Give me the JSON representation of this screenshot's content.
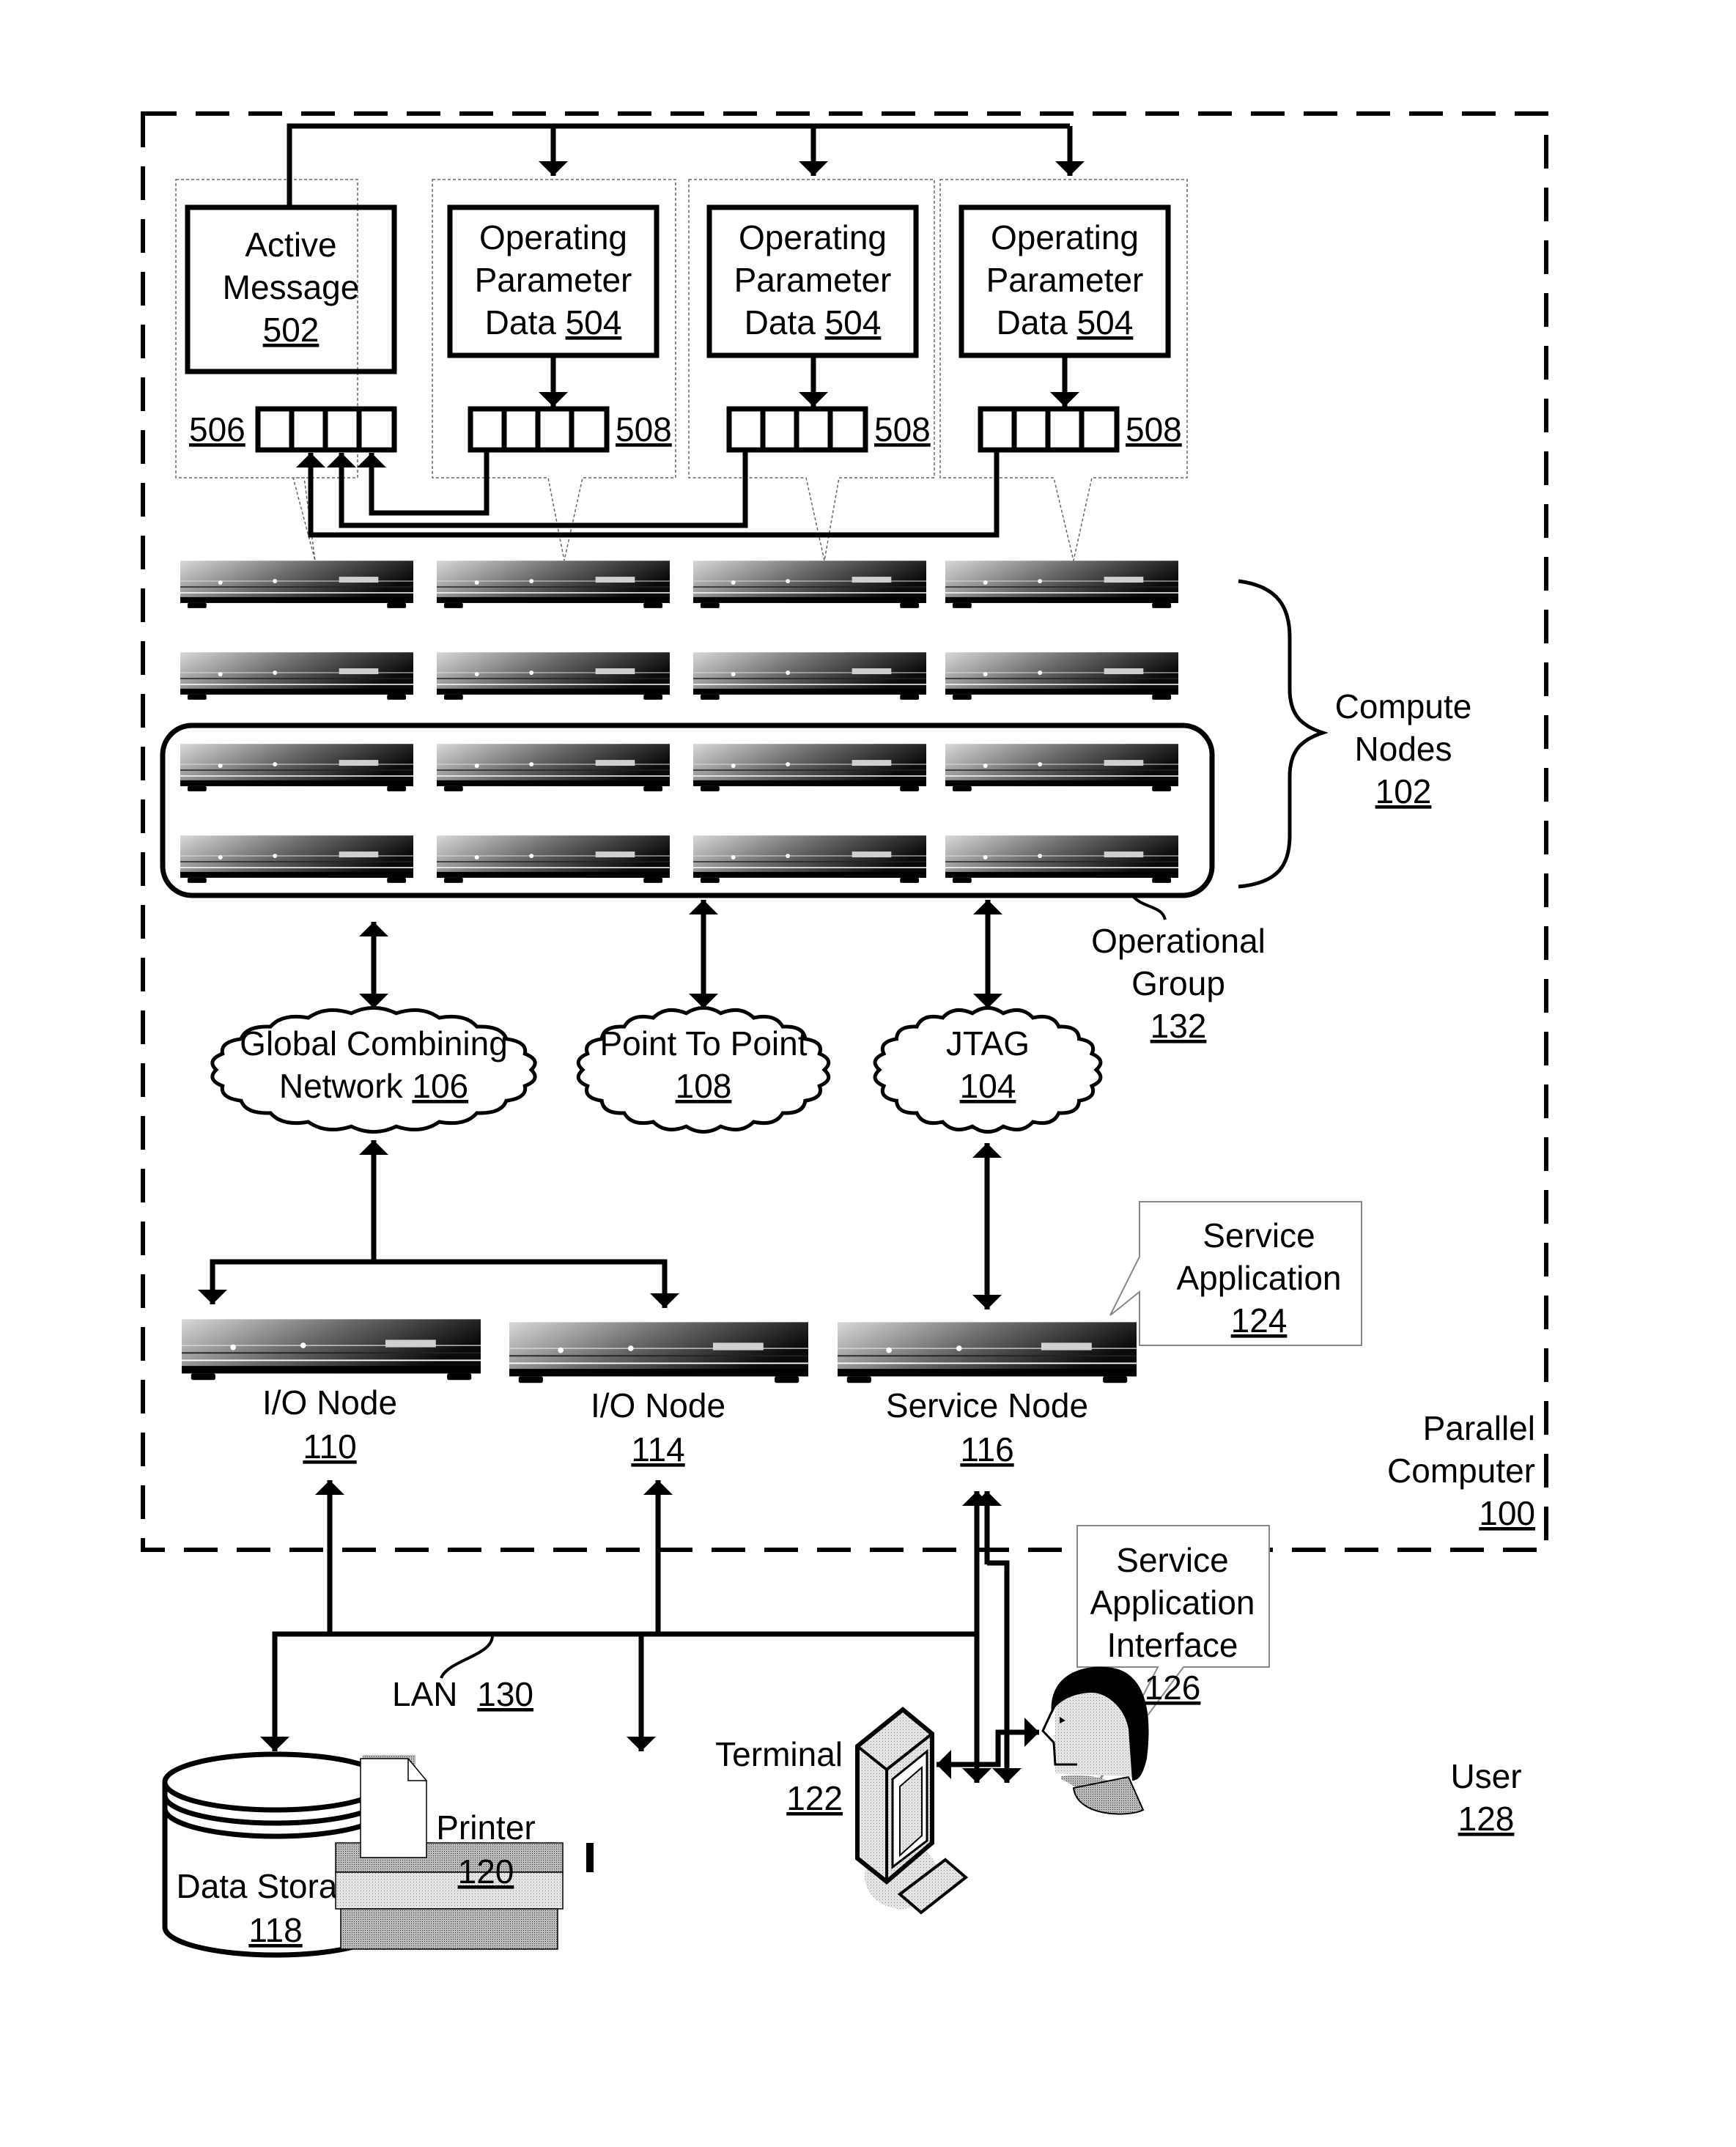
{
  "figure": {
    "parallel_computer": {
      "label_lines": [
        "Parallel",
        "Computer"
      ],
      "ref": "100"
    },
    "active_message": {
      "label_lines": [
        "Active",
        "Message"
      ],
      "ref": "502"
    },
    "operating_parameter_data": [
      {
        "label_lines": [
          "Operating",
          "Parameter"
        ],
        "label_prefix": "Data",
        "ref": "504",
        "buffer_ref": "508"
      },
      {
        "label_lines": [
          "Operating",
          "Parameter"
        ],
        "label_prefix": "Data",
        "ref": "504",
        "buffer_ref": "508"
      },
      {
        "label_lines": [
          "Operating",
          "Parameter"
        ],
        "label_prefix": "Data",
        "ref": "504",
        "buffer_ref": "508"
      }
    ],
    "active_message_buffer_ref": "506",
    "compute_nodes": {
      "label_lines": [
        "Compute",
        "Nodes"
      ],
      "ref": "102",
      "rows": 4,
      "cols": 4
    },
    "operational_group": {
      "label_lines": [
        "Operational",
        "Group"
      ],
      "ref": "132"
    },
    "networks": [
      {
        "id": "global-combining-network",
        "line1": "Global Combining",
        "line2_prefix": "Network",
        "ref": "106"
      },
      {
        "id": "point-to-point-network",
        "line1": "Point To Point",
        "line2_prefix": "",
        "ref": "108"
      },
      {
        "id": "jtag-network",
        "line1": "JTAG",
        "line2_prefix": "",
        "ref": "104"
      }
    ],
    "io_nodes": [
      {
        "label": "I/O Node",
        "ref": "110"
      },
      {
        "label": "I/O Node",
        "ref": "114"
      }
    ],
    "service_node": {
      "label": "Service Node",
      "ref": "116"
    },
    "service_application": {
      "label_lines": [
        "Service",
        "Application"
      ],
      "ref": "124"
    },
    "service_application_interface": {
      "label_lines": [
        "Service",
        "Application",
        "Interface"
      ],
      "ref": "126"
    },
    "lan": {
      "label": "LAN",
      "ref": "130"
    },
    "data_storage": {
      "label": "Data Storage",
      "ref": "118"
    },
    "printer": {
      "label": "Printer",
      "ref": "120"
    },
    "terminal": {
      "label": "Terminal",
      "ref": "122"
    },
    "user": {
      "label": "User",
      "ref": "128"
    }
  }
}
